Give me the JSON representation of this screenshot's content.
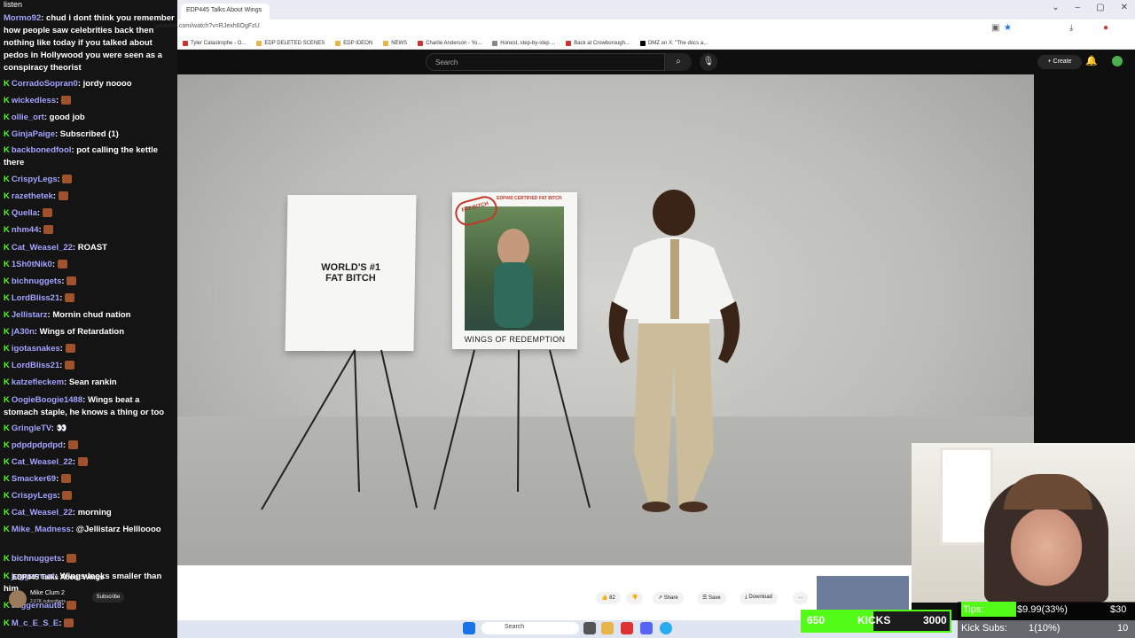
{
  "browser": {
    "tab_title": "EDP445 Talks About Wings",
    "url": "youtube.com/watch?v=RJexh6OgFzU",
    "bookmarks": [
      "Tyler Catastrophe - O...",
      "EDP DELETED SCENES",
      "EDP IDEON",
      "NEWS",
      "Charlie Anderson - Yo...",
      "Honest, step-by-step ...",
      "Back at Crowborough...",
      "DMZ on X: \"The docs a..."
    ]
  },
  "youtube": {
    "search_placeholder": "Search",
    "create_label": "Create",
    "likes": "82",
    "share_label": "Share",
    "save_label": "Save",
    "download_label": "Download",
    "channel_name": "Mike Clum 2",
    "channel_subs": "2.67K subscribers",
    "subscribe_label": "Subscribe",
    "overlap_title": "EDP445 Talks About Wings",
    "more_label": "..."
  },
  "video": {
    "board1_line1": "WORLD'S #1",
    "board1_line2": "FAT BITCH",
    "stamp": "FAT BITCH",
    "board2_top": "EDP445 CERTIFIED FAT BITCH",
    "board2_caption": "WINGS OF REDEMPTION"
  },
  "chat": {
    "top_text": "chud i dont think you remember how people saw celebrities back then nothing like today if you talked about pedos in Hollywood you were seen as a conspiracy theorist",
    "top_user": "Mormo92",
    "messages": [
      {
        "user": "CorradoSopran0",
        "text": "jordy noooo"
      },
      {
        "user": "wickedless",
        "text": ""
      },
      {
        "user": "ollie_ort",
        "text": "good job"
      },
      {
        "user": "GinjaPaige",
        "text": "Subscribed (1)"
      },
      {
        "user": "backbonedfool",
        "text": "pot calling the kettle there"
      },
      {
        "user": "CrispyLegs",
        "text": ""
      },
      {
        "user": "razethetek",
        "text": ""
      },
      {
        "user": "Quella",
        "text": ""
      },
      {
        "user": "nhm44",
        "text": ""
      },
      {
        "user": "Cat_Weasel_22",
        "text": "ROAST"
      },
      {
        "user": "1Sh0tNik0",
        "text": ""
      },
      {
        "user": "bichnuggets",
        "text": ""
      },
      {
        "user": "LordBliss21",
        "text": ""
      },
      {
        "user": "Jellistarz",
        "text": "Mornin chud nation"
      },
      {
        "user": "jA30n",
        "text": "Wings of Retardation"
      },
      {
        "user": "igotasnakes",
        "text": ""
      },
      {
        "user": "LordBliss21",
        "text": ""
      },
      {
        "user": "katzefleckem",
        "text": "Sean rankin"
      },
      {
        "user": "OogieBoogie1488",
        "text": "Wings beat a stomach staple, he knows a thing or too"
      },
      {
        "user": "GringleTV",
        "text": "👀"
      },
      {
        "user": "pdpdpdpdpd",
        "text": ""
      },
      {
        "user": "Cat_Weasel_22",
        "text": ""
      },
      {
        "user": "Smacker69",
        "text": ""
      },
      {
        "user": "CrispyLegs",
        "text": ""
      },
      {
        "user": "Cat_Weasel_22",
        "text": "morning"
      },
      {
        "user": "Mike_Madness",
        "text": "@Jellistarz Hellloooo"
      },
      {
        "user": "bichnuggets",
        "text": ""
      },
      {
        "user": "juggernaut",
        "text": "Wings looks smaller than him"
      },
      {
        "user": "Jaggernaut8",
        "text": ""
      },
      {
        "user": "M_c_E_S_E",
        "text": ""
      }
    ]
  },
  "goals": {
    "kicks_left": "650",
    "kicks_label": "KICKS",
    "kicks_right": "3000",
    "tips_label": "Tips:",
    "tips_value": "$9.99(33%)",
    "tips_goal": "$30",
    "subs_label": "Kick Subs:",
    "subs_value": "1(10%)",
    "subs_goal": "10"
  },
  "taskbar": {
    "search_placeholder": "Search"
  }
}
